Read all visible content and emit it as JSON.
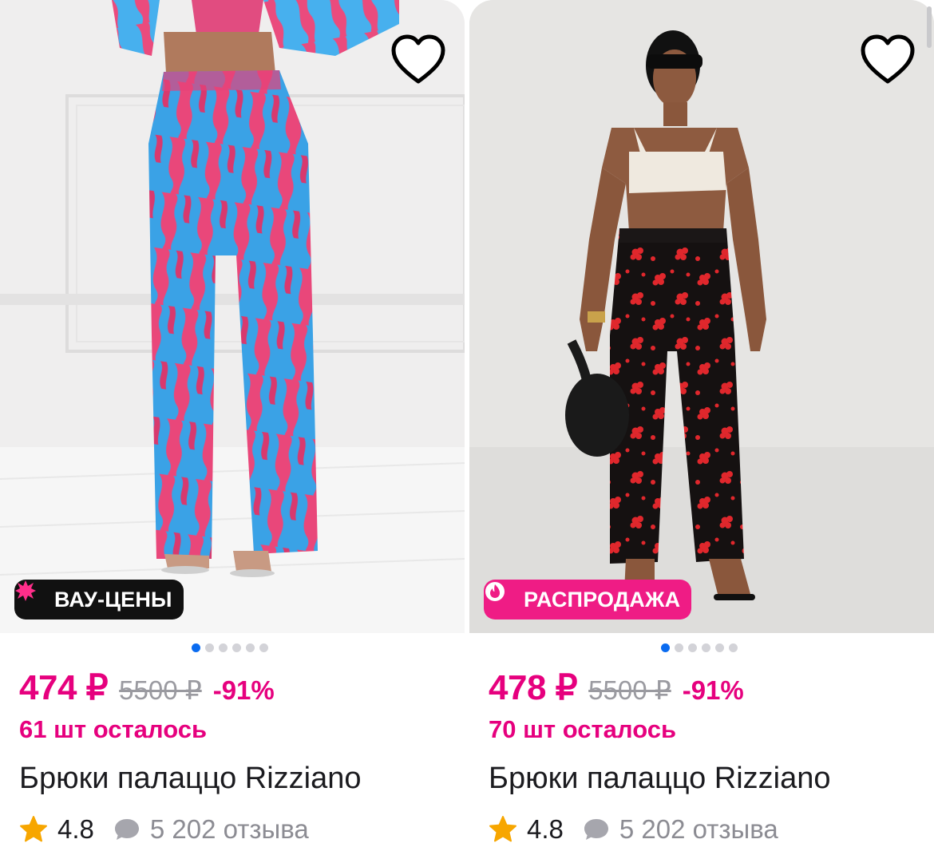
{
  "colors": {
    "accent": "#e6007e",
    "dot_active": "#0a6bf0",
    "dot_inactive": "#d3d3d8",
    "badge_dark": "#111111",
    "badge_sale": "#ef1c85",
    "star": "#f7a600",
    "muted": "#9a9aa0"
  },
  "products": [
    {
      "badge_label": "ВАУ-ЦЕНЫ",
      "badge_icon": "starburst-icon",
      "image_slides": 6,
      "active_slide": 1,
      "price": "474 ₽",
      "old_price": "5500 ₽",
      "discount": "-91%",
      "stock": "61 шт осталось",
      "title": "Брюки палаццо Rizziano",
      "rating": "4.8",
      "reviews": "5 202 отзыва"
    },
    {
      "badge_label": "РАСПРОДАЖА",
      "badge_icon": "flame-icon",
      "image_slides": 6,
      "active_slide": 1,
      "price": "478 ₽",
      "old_price": "5500 ₽",
      "discount": "-91%",
      "stock": "70 шт осталось",
      "title": "Брюки палаццо Rizziano",
      "rating": "4.8",
      "reviews": "5 202 отзыва"
    }
  ]
}
